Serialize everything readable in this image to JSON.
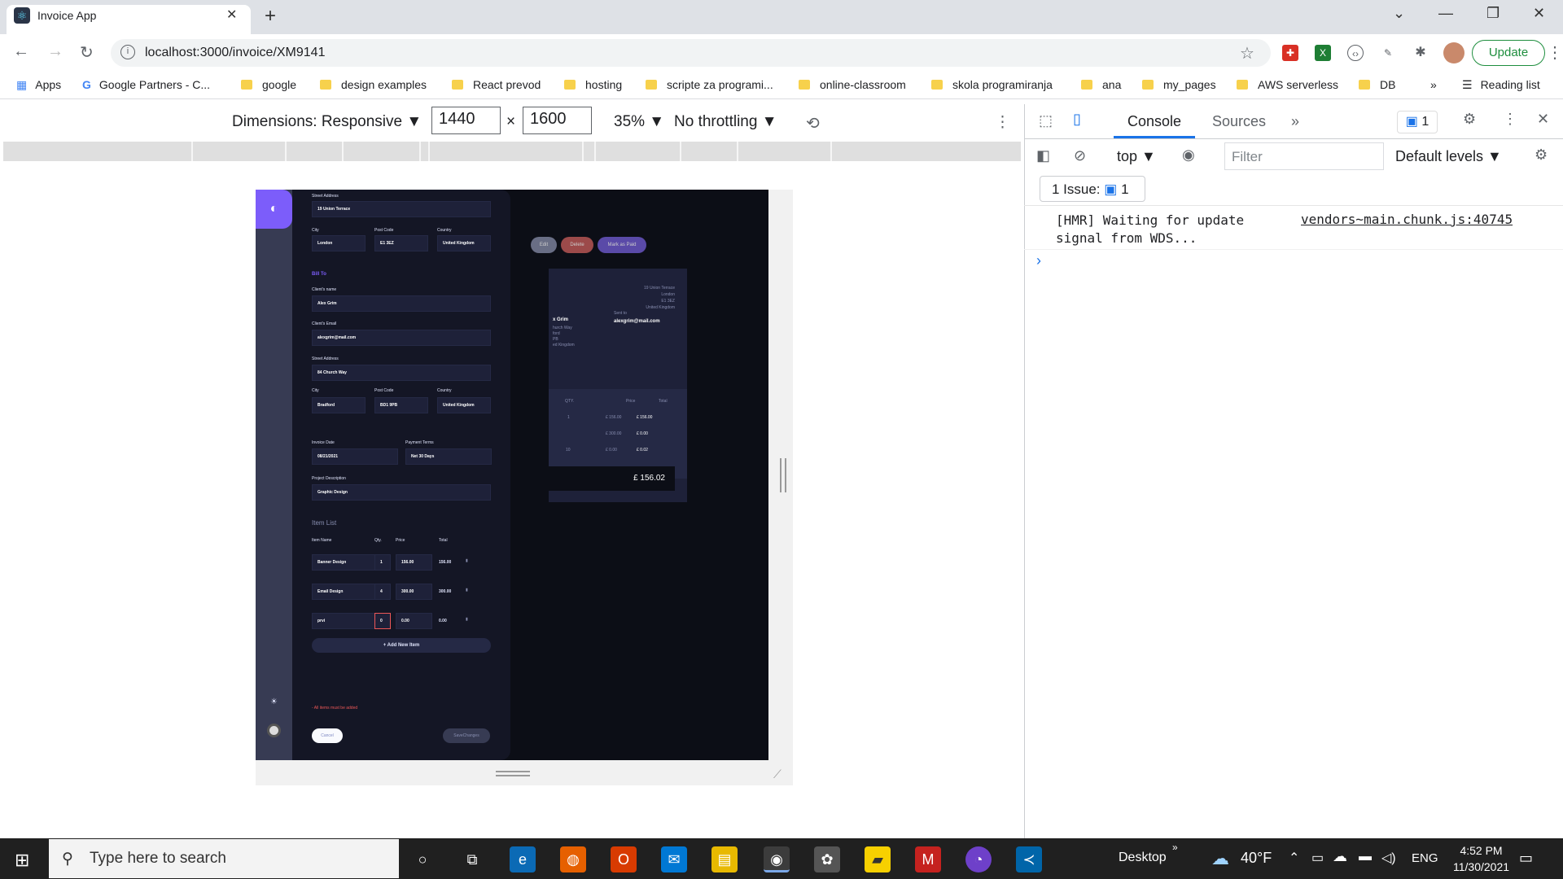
{
  "browser": {
    "tab_title": "Invoice App",
    "url": "localhost:3000/invoice/XM9141",
    "update_label": "Update",
    "new_tab_icon": "+",
    "bookmarks": [
      "Apps",
      "Google Partners - C...",
      "google",
      "design examples",
      "React prevod",
      "hosting",
      "scripte za programi...",
      "online-classroom",
      "skola programiranja",
      "ana",
      "my_pages",
      "AWS serverless",
      "DB"
    ],
    "reading_list": "Reading list",
    "more_bookmarks": "»"
  },
  "device_toolbar": {
    "dimensions_label": "Dimensions: Responsive ▼",
    "width": "1440",
    "times": "×",
    "height": "1600",
    "zoom": "35% ▼",
    "throttling": "No throttling ▼"
  },
  "app": {
    "form": {
      "street_label": "Street Address",
      "street_value": "19 Union Terrace",
      "city_label": "City",
      "city_value": "London",
      "postcode_label": "Post Code",
      "postcode_value": "E1 3EZ",
      "country_label": "Country",
      "country_value": "United Kingdom",
      "bill_to": "Bill To",
      "client_name_label": "Client's name",
      "client_name_value": "Alex Grim",
      "client_email_label": "Client's Email",
      "client_email_value": "alexgrim@mail.com",
      "client_street_label": "Street Address",
      "client_street_value": "84 Church Way",
      "client_city_label": "City",
      "client_city_value": "Bradford",
      "client_postcode_label": "Post Code",
      "client_postcode_value": "BD1 9PB",
      "client_country_label": "Country",
      "client_country_value": "United Kingdom",
      "invoice_date_label": "Invoice Date",
      "invoice_date_value": "08/21/2021",
      "payment_terms_label": "Payment Terms",
      "payment_terms_value": "Net 30 Days",
      "project_label": "Project Description",
      "project_value": "Graphic Design",
      "item_list_title": "Item List",
      "col_name": "Item Name",
      "col_qty": "Qty.",
      "col_price": "Price",
      "col_total": "Total",
      "items": [
        {
          "name": "Banner Design",
          "qty": "1",
          "price": "156.00",
          "total": "156.00"
        },
        {
          "name": "Email Design",
          "qty": "4",
          "price": "300.00",
          "total": "300.00"
        },
        {
          "name": "prvi",
          "qty": "0",
          "price": "0.00",
          "total": "0.00"
        }
      ],
      "add_item": "+ Add New Item",
      "error": "- All items must be added",
      "cancel": "Cancel",
      "save": "SaveChanges"
    },
    "background": {
      "edit": "Edit",
      "delete": "Delete",
      "mark_paid": "Mark as Paid",
      "sender_address": [
        "19 Union Terrace",
        "London",
        "E1 3EZ",
        "United Kingdom"
      ],
      "sent_to_label": "Sent to",
      "sent_to": "alexgrim@mail.com",
      "client_name": "x Grim",
      "client_address": [
        "hurch Way",
        "ford",
        "PB",
        "ed Kingdom"
      ],
      "col_qty": "QTY.",
      "col_price": "Price",
      "col_total": "Total",
      "rows": [
        {
          "qty": "1",
          "price": "£ 156.00",
          "total": "£ 156.00"
        },
        {
          "qty": "",
          "price": "£ 300.00",
          "total": "£ 0.00"
        },
        {
          "qty": "10",
          "price": "£ 0.00",
          "total": "£ 0.02"
        }
      ],
      "amount": "£ 156.02"
    }
  },
  "devtools": {
    "tabs": [
      "Console",
      "Sources",
      "»"
    ],
    "issues_badge": "1",
    "context": "top ▼",
    "filter_placeholder": "Filter",
    "levels": "Default levels ▼",
    "issues": "1 Issue:",
    "issues_count": "1",
    "log_message": "[HMR] Waiting for update\nsignal from WDS...",
    "log_source": "vendors~main.chunk.js:40745",
    "prompt": "›"
  },
  "taskbar": {
    "search_placeholder": "Type here to search",
    "desktop": "Desktop",
    "temperature": "40°F",
    "lang": "ENG",
    "time": "4:52 PM",
    "date": "11/30/2021"
  }
}
